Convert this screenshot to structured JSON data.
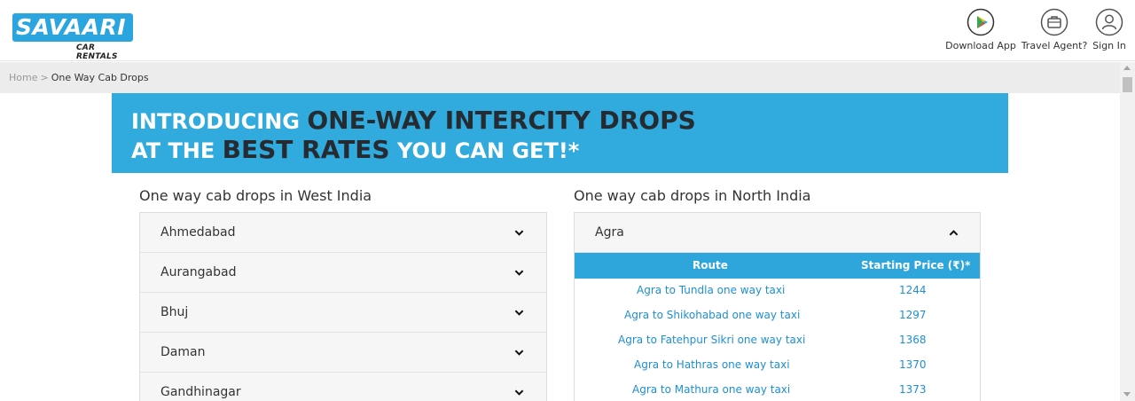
{
  "header": {
    "logo_text": "SAVAARI",
    "logo_sub": "CAR RENTALS",
    "actions": [
      {
        "label": "Download App",
        "icon": "play-store-icon"
      },
      {
        "label": "Travel Agent?",
        "icon": "briefcase-icon"
      },
      {
        "label": "Sign In",
        "icon": "user-icon"
      }
    ]
  },
  "breadcrumb": {
    "home": "Home",
    "separator": ">",
    "current": "One Way Cab Drops"
  },
  "banner": {
    "line1_a": "INTRODUCING ",
    "line1_b": "ONE-WAY INTERCITY DROPS",
    "line2_a": "AT THE ",
    "line2_b": "BEST RATES",
    "line2_c": " YOU CAN GET!*",
    "background": "#31aadd"
  },
  "west": {
    "title": "One way cab drops in West India",
    "cities": [
      "Ahmedabad",
      "Aurangabad",
      "Bhuj",
      "Daman",
      "Gandhinagar"
    ]
  },
  "north": {
    "title": "One way cab drops in North India",
    "expanded_city": "Agra",
    "table": {
      "headers": [
        "Route",
        "Starting Price (₹)*"
      ],
      "rows": [
        {
          "route": "Agra to Tundla one way taxi",
          "price": "1244"
        },
        {
          "route": "Agra to Shikohabad one way taxi",
          "price": "1297"
        },
        {
          "route": "Agra to Fatehpur Sikri one way taxi",
          "price": "1368"
        },
        {
          "route": "Agra to Hathras one way taxi",
          "price": "1370"
        },
        {
          "route": "Agra to Mathura one way taxi",
          "price": "1373"
        }
      ]
    }
  },
  "colors": {
    "accent": "#2aa5df",
    "link": "#1d8fd3",
    "table_header": "#2ea6dc"
  }
}
